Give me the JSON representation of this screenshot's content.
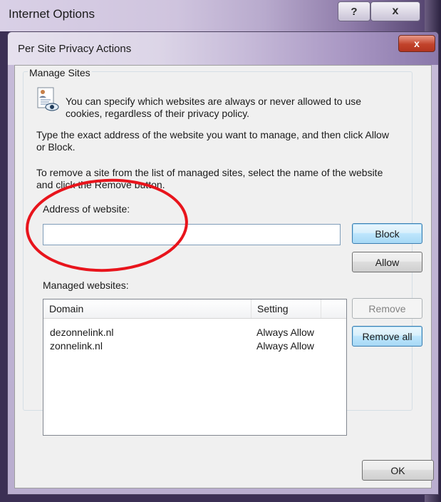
{
  "background_window": {
    "title": "Internet Options",
    "help_label": "?",
    "close_label": "x"
  },
  "dialog": {
    "title": "Per Site Privacy Actions",
    "close_label": "x"
  },
  "manage_sites": {
    "legend": "Manage Sites",
    "info_line1": "You can specify which websites are always or never allowed to use",
    "info_line2": "cookies, regardless of their privacy policy.",
    "instruction_line1": "Type the exact address of the website you want to manage, and then click Allow",
    "instruction_line2": "or Block.",
    "remove_line1": "To remove a site from the list of managed sites, select the name of the website",
    "remove_line2": "and click the Remove button.",
    "address_label": "Address of website:",
    "address_value": "",
    "block_label": "Block",
    "allow_label": "Allow",
    "managed_label": "Managed websites:",
    "remove_label": "Remove",
    "remove_all_label": "Remove all"
  },
  "managed_list": {
    "columns": [
      "Domain",
      "Setting"
    ],
    "rows": [
      {
        "domain": "dezonnelink.nl",
        "setting": "Always Allow"
      },
      {
        "domain": "zonnelink.nl",
        "setting": "Always Allow"
      }
    ]
  },
  "footer": {
    "ok_label": "OK"
  },
  "colors": {
    "annotation": "#e8141c",
    "accent": "#3c7fb1"
  }
}
